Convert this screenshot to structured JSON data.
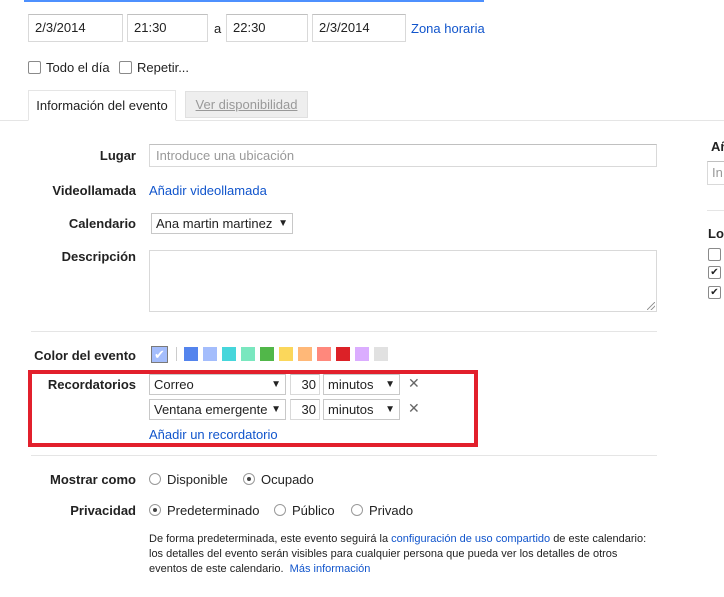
{
  "datetime": {
    "start_date": "2/3/2014",
    "start_time": "21:30",
    "separator": "a",
    "end_time": "22:30",
    "end_date": "2/3/2014",
    "timezone_link": "Zona horaria"
  },
  "options": {
    "all_day": "Todo el día",
    "repeat": "Repetir..."
  },
  "tabs": {
    "event_info": "Información del evento",
    "availability": "Ver disponibilidad"
  },
  "form": {
    "location_label": "Lugar",
    "location_placeholder": "Introduce una ubicación",
    "videocall_label": "Videollamada",
    "videocall_link": "Añadir videollamada",
    "calendar_label": "Calendario",
    "calendar_value": "Ana martin martinez",
    "description_label": "Descripción",
    "color_label": "Color del evento",
    "reminders_label": "Recordatorios",
    "reminders": [
      {
        "method": "Correo",
        "amount": "30",
        "unit": "minutos"
      },
      {
        "method": "Ventana emergente",
        "amount": "30",
        "unit": "minutos"
      }
    ],
    "add_reminder_link": "Añadir un recordatorio",
    "show_as_label": "Mostrar como",
    "show_as_options": [
      "Disponible",
      "Ocupado"
    ],
    "show_as_selected": "Ocupado",
    "privacy_label": "Privacidad",
    "privacy_options": [
      "Predeterminado",
      "Público",
      "Privado"
    ],
    "privacy_selected": "Predeterminado",
    "privacy_note_1": "De forma predeterminada, este evento seguirá la",
    "privacy_note_link": "configuración de uso compartido",
    "privacy_note_2": "de este calendario:",
    "privacy_note_3": "los detalles del evento serán visibles para cualquier persona que pueda ver los detalles de otros",
    "privacy_note_4": "eventos de este calendario.",
    "more_info_link": "Más información"
  },
  "colors": {
    "swatches": [
      "#5484ed",
      "#a4bdfc",
      "#46d6db",
      "#7ae7bf",
      "#51b749",
      "#fbd75b",
      "#ffb878",
      "#ff887c",
      "#dc2127",
      "#dbadff",
      "#e1e1e1"
    ],
    "selected": "#a4bdfc",
    "highlight_box": "#e2202c",
    "link": "#1155cc"
  },
  "right_panel": {
    "heading_1": "Añ",
    "input_fragment": "In",
    "heading_2": "Lo"
  }
}
